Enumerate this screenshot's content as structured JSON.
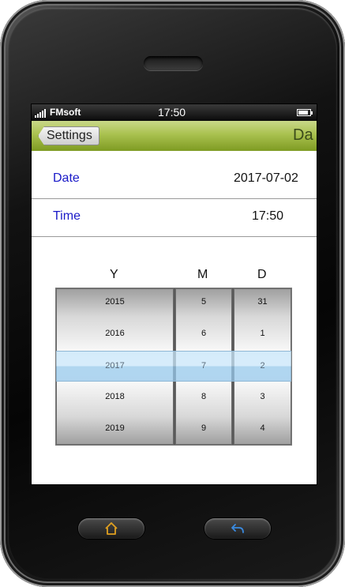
{
  "status_bar": {
    "carrier": "FMsoft",
    "time": "17:50",
    "battery_level": 0.85
  },
  "nav": {
    "back_label": "Settings",
    "title": "Da"
  },
  "rows": [
    {
      "label": "Date",
      "value": "2017-07-02"
    },
    {
      "label": "Time",
      "value": "17:50"
    }
  ],
  "picker": {
    "headers": {
      "year": "Y",
      "month": "M",
      "day": "D"
    },
    "years": [
      "2015",
      "2016",
      "2017",
      "2018",
      "2019"
    ],
    "months": [
      "5",
      "6",
      "7",
      "8",
      "9"
    ],
    "days": [
      "31",
      "1",
      "2",
      "3",
      "4"
    ],
    "selected": {
      "year": "2017",
      "month": "7",
      "day": "2"
    }
  },
  "hardware_buttons": {
    "home": "home-icon",
    "back": "back-arrow-icon"
  },
  "colors": {
    "navbar_top": "#c9d889",
    "navbar_bottom": "#7e9b22",
    "label_blue": "#1a1ac8",
    "selection": "#c8e6fa",
    "home_icon": "#e0a020",
    "back_icon": "#3a8ae0"
  }
}
